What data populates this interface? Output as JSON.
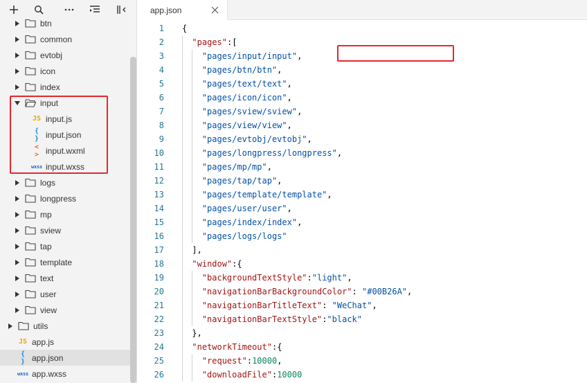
{
  "sidebar": {
    "toolbar": [
      {
        "name": "add-icon",
        "label": "+"
      },
      {
        "name": "search-icon",
        "label": "search"
      },
      {
        "name": "more-icon",
        "label": "..."
      },
      {
        "name": "collapse-all-icon",
        "label": "collapse"
      },
      {
        "name": "toggle-panel-icon",
        "label": "panel"
      }
    ],
    "tree": [
      {
        "label": "btn",
        "type": "folder",
        "expanded": false,
        "depth": 1
      },
      {
        "label": "common",
        "type": "folder",
        "expanded": false,
        "depth": 1
      },
      {
        "label": "evtobj",
        "type": "folder",
        "expanded": false,
        "depth": 1
      },
      {
        "label": "icon",
        "type": "folder",
        "expanded": false,
        "depth": 1
      },
      {
        "label": "index",
        "type": "folder",
        "expanded": false,
        "depth": 1
      },
      {
        "label": "input",
        "type": "folder",
        "expanded": true,
        "depth": 1
      },
      {
        "label": "input.js",
        "type": "js",
        "depth": 2,
        "icon_text": "JS"
      },
      {
        "label": "input.json",
        "type": "json",
        "depth": 2,
        "icon_text": "{ }"
      },
      {
        "label": "input.wxml",
        "type": "wxml",
        "depth": 2,
        "icon_text": "< >"
      },
      {
        "label": "input.wxss",
        "type": "wxss",
        "depth": 2,
        "icon_text": "wxss"
      },
      {
        "label": "logs",
        "type": "folder",
        "expanded": false,
        "depth": 1
      },
      {
        "label": "longpress",
        "type": "folder",
        "expanded": false,
        "depth": 1
      },
      {
        "label": "mp",
        "type": "folder",
        "expanded": false,
        "depth": 1
      },
      {
        "label": "sview",
        "type": "folder",
        "expanded": false,
        "depth": 1
      },
      {
        "label": "tap",
        "type": "folder",
        "expanded": false,
        "depth": 1
      },
      {
        "label": "template",
        "type": "folder",
        "expanded": false,
        "depth": 1
      },
      {
        "label": "text",
        "type": "folder",
        "expanded": false,
        "depth": 1
      },
      {
        "label": "user",
        "type": "folder",
        "expanded": false,
        "depth": 1
      },
      {
        "label": "view",
        "type": "folder",
        "expanded": false,
        "depth": 1
      },
      {
        "label": "utils",
        "type": "folder",
        "expanded": false,
        "depth": 0
      },
      {
        "label": "app.js",
        "type": "js",
        "depth": 0,
        "icon_text": "JS"
      },
      {
        "label": "app.json",
        "type": "json",
        "depth": 0,
        "icon_text": "{ }",
        "selected": true
      },
      {
        "label": "app.wxss",
        "type": "wxss",
        "depth": 0,
        "icon_text": "wxss"
      }
    ]
  },
  "editor": {
    "tab": {
      "label": "app.json"
    },
    "lines": [
      {
        "n": "1",
        "indent": 0,
        "tokens": [
          {
            "t": "{",
            "c": "p"
          }
        ]
      },
      {
        "n": "2",
        "indent": 1,
        "tokens": [
          {
            "t": "\"pages\"",
            "c": "k"
          },
          {
            "t": ":[",
            "c": "p"
          }
        ]
      },
      {
        "n": "3",
        "indent": 2,
        "tokens": [
          {
            "t": "\"pages/input/input\"",
            "c": "s"
          },
          {
            "t": ",",
            "c": "p"
          }
        ]
      },
      {
        "n": "4",
        "indent": 2,
        "tokens": [
          {
            "t": "\"pages/btn/btn\"",
            "c": "s"
          },
          {
            "t": ",",
            "c": "p"
          }
        ]
      },
      {
        "n": "5",
        "indent": 2,
        "tokens": [
          {
            "t": "\"pages/text/text\"",
            "c": "s"
          },
          {
            "t": ",",
            "c": "p"
          }
        ]
      },
      {
        "n": "6",
        "indent": 2,
        "tokens": [
          {
            "t": "\"pages/icon/icon\"",
            "c": "s"
          },
          {
            "t": ",",
            "c": "p"
          }
        ]
      },
      {
        "n": "7",
        "indent": 2,
        "tokens": [
          {
            "t": "\"pages/sview/sview\"",
            "c": "s"
          },
          {
            "t": ",",
            "c": "p"
          }
        ]
      },
      {
        "n": "8",
        "indent": 2,
        "tokens": [
          {
            "t": "\"pages/view/view\"",
            "c": "s"
          },
          {
            "t": ",",
            "c": "p"
          }
        ]
      },
      {
        "n": "9",
        "indent": 2,
        "tokens": [
          {
            "t": "\"pages/evtobj/evtobj\"",
            "c": "s"
          },
          {
            "t": ",",
            "c": "p"
          }
        ]
      },
      {
        "n": "10",
        "indent": 2,
        "tokens": [
          {
            "t": "\"pages/longpress/longpress\"",
            "c": "s"
          },
          {
            "t": ",",
            "c": "p"
          }
        ]
      },
      {
        "n": "11",
        "indent": 2,
        "tokens": [
          {
            "t": "\"pages/mp/mp\"",
            "c": "s"
          },
          {
            "t": ",",
            "c": "p"
          }
        ]
      },
      {
        "n": "12",
        "indent": 2,
        "tokens": [
          {
            "t": "\"pages/tap/tap\"",
            "c": "s"
          },
          {
            "t": ",",
            "c": "p"
          }
        ]
      },
      {
        "n": "13",
        "indent": 2,
        "tokens": [
          {
            "t": "\"pages/template/template\"",
            "c": "s"
          },
          {
            "t": ",",
            "c": "p"
          }
        ]
      },
      {
        "n": "14",
        "indent": 2,
        "tokens": [
          {
            "t": "\"pages/user/user\"",
            "c": "s"
          },
          {
            "t": ",",
            "c": "p"
          }
        ]
      },
      {
        "n": "15",
        "indent": 2,
        "tokens": [
          {
            "t": "\"pages/index/index\"",
            "c": "s"
          },
          {
            "t": ",",
            "c": "p"
          }
        ]
      },
      {
        "n": "16",
        "indent": 2,
        "tokens": [
          {
            "t": "\"pages/logs/logs\"",
            "c": "s"
          }
        ]
      },
      {
        "n": "17",
        "indent": 1,
        "tokens": [
          {
            "t": "],",
            "c": "p"
          }
        ]
      },
      {
        "n": "18",
        "indent": 1,
        "tokens": [
          {
            "t": "\"window\"",
            "c": "k"
          },
          {
            "t": ":{",
            "c": "p"
          }
        ]
      },
      {
        "n": "19",
        "indent": 2,
        "tokens": [
          {
            "t": "\"backgroundTextStyle\"",
            "c": "k"
          },
          {
            "t": ":",
            "c": "p"
          },
          {
            "t": "\"light\"",
            "c": "s"
          },
          {
            "t": ",",
            "c": "p"
          }
        ]
      },
      {
        "n": "20",
        "indent": 2,
        "tokens": [
          {
            "t": "\"navigationBarBackgroundColor\"",
            "c": "k"
          },
          {
            "t": ": ",
            "c": "p"
          },
          {
            "t": "\"#00B26A\"",
            "c": "s"
          },
          {
            "t": ",",
            "c": "p"
          }
        ]
      },
      {
        "n": "21",
        "indent": 2,
        "tokens": [
          {
            "t": "\"navigationBarTitleText\"",
            "c": "k"
          },
          {
            "t": ": ",
            "c": "p"
          },
          {
            "t": "\"WeChat\"",
            "c": "s"
          },
          {
            "t": ",",
            "c": "p"
          }
        ]
      },
      {
        "n": "22",
        "indent": 2,
        "tokens": [
          {
            "t": "\"navigationBarTextStyle\"",
            "c": "k"
          },
          {
            "t": ":",
            "c": "p"
          },
          {
            "t": "\"black\"",
            "c": "s"
          }
        ]
      },
      {
        "n": "23",
        "indent": 1,
        "tokens": [
          {
            "t": "},",
            "c": "p"
          }
        ]
      },
      {
        "n": "24",
        "indent": 1,
        "tokens": [
          {
            "t": "\"networkTimeout\"",
            "c": "k"
          },
          {
            "t": ":{",
            "c": "p"
          }
        ]
      },
      {
        "n": "25",
        "indent": 2,
        "tokens": [
          {
            "t": "\"request\"",
            "c": "k"
          },
          {
            "t": ":",
            "c": "p"
          },
          {
            "t": "10000",
            "c": "n"
          },
          {
            "t": ",",
            "c": "p"
          }
        ]
      },
      {
        "n": "26",
        "indent": 2,
        "tokens": [
          {
            "t": "\"downloadFile\"",
            "c": "k"
          },
          {
            "t": ":",
            "c": "p"
          },
          {
            "t": "10000",
            "c": "n"
          }
        ]
      }
    ]
  },
  "colors": {
    "highlight": "#e5262e",
    "line_number": "#237893",
    "key": "#a31515",
    "string": "#0451a5",
    "number": "#098658"
  }
}
